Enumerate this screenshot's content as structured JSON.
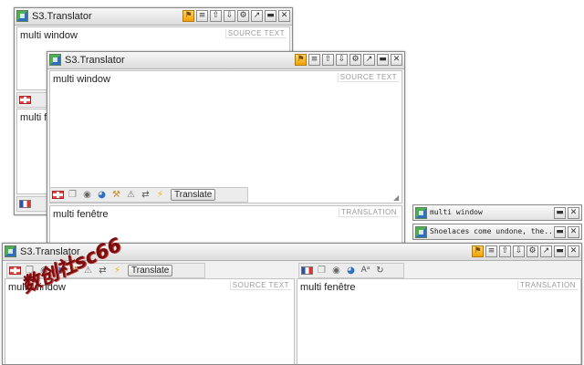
{
  "app": {
    "title": "S3.Translator"
  },
  "title_buttons": [
    "⚑",
    "≡",
    "⇧",
    "⇩",
    "⚙",
    "↗",
    "▬",
    "✕"
  ],
  "title_buttons_small": [
    "▬",
    "✕"
  ],
  "labels": {
    "source": "SOURCE TEXT",
    "translation": "TRANSLATION"
  },
  "translate_button": "Translate",
  "window_back": {
    "source_text": "multi window",
    "translation_text": "multi fe"
  },
  "window_mid": {
    "source_text": "multi window",
    "translation_text": "multi fenêtre"
  },
  "window_front": {
    "source_text": "multi window",
    "translation_text": "multi fenêtre"
  },
  "mini_windows": [
    {
      "text": "multi window"
    },
    {
      "text": "Shoelaces come undone, the..."
    }
  ],
  "watermark": "数创社sc66",
  "icons": {
    "flag_source": "flag-en",
    "flag_target": "flag-fr",
    "copy": "❐",
    "sound": "◉",
    "globe": "◕",
    "broom": "⚒",
    "warn": "⚠",
    "swap": "⇄",
    "bolt": "⚡",
    "font": "Aᵃ",
    "refresh": "↻",
    "resize": "◢"
  },
  "colors": {
    "accent_orange": "#f0a200",
    "title_bg": "#e4e4e4",
    "border": "#8a8a8a"
  }
}
